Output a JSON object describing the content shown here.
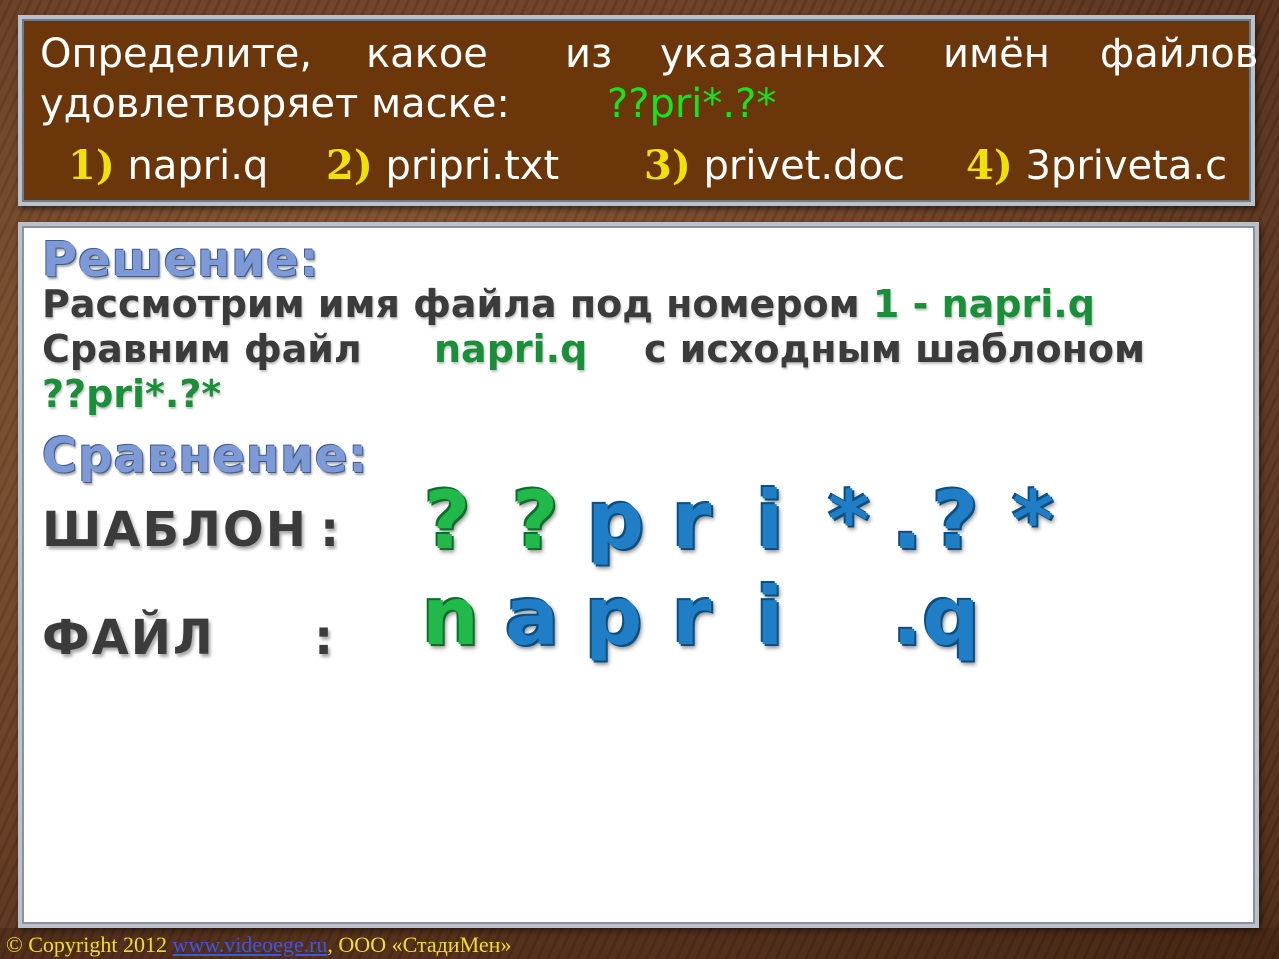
{
  "question": {
    "line1_words": [
      "Определите,",
      "какое",
      "из",
      "указанных",
      "имён",
      "файлов"
    ],
    "line2_text": "удовлетворяет маске:",
    "mask": "??pri*.?*",
    "options": [
      {
        "num": "1)",
        "name": "napri.q"
      },
      {
        "num": "2)",
        "name": "pripri.txt"
      },
      {
        "num": "3)",
        "name": "privet.doc"
      },
      {
        "num": "4)",
        "name": "3priveta.c"
      }
    ]
  },
  "solution": {
    "heading": "Решение:",
    "line1_text": "Рассмотрим имя файла под номером",
    "line1_highlight": "1 - napri.q",
    "line2_text": "Сравним файл",
    "line2_file": "napri.q",
    "line2_tail": "с исходным шаблоном",
    "line3_mask": "??pri*.?*"
  },
  "comparison": {
    "heading": "Сравнение:",
    "template_label": "ШАБЛОН",
    "file_label": "ФАЙЛ",
    "colon": ":",
    "template_chars": [
      "?",
      "?",
      "p",
      "r",
      "i",
      "*",
      ".",
      "?",
      "*"
    ],
    "file_chars": [
      "n",
      "a",
      "p",
      "r",
      "i",
      ".q"
    ]
  },
  "footer": {
    "copyright": "© Copyright 2012",
    "link": "www.videoege.ru",
    "separator": ",",
    "company": "ООО «СтадиМен»"
  },
  "colors": {
    "question_bg": "#6b3609",
    "mask_green": "#19e21e",
    "option_number": "#f1e108",
    "heading_blue": "#7d9ad6",
    "highlight_green": "#1b8e3a",
    "big_blue": "#1f7ec6",
    "big_green": "#20b94a",
    "footer_yellow": "#f2dd2c"
  }
}
